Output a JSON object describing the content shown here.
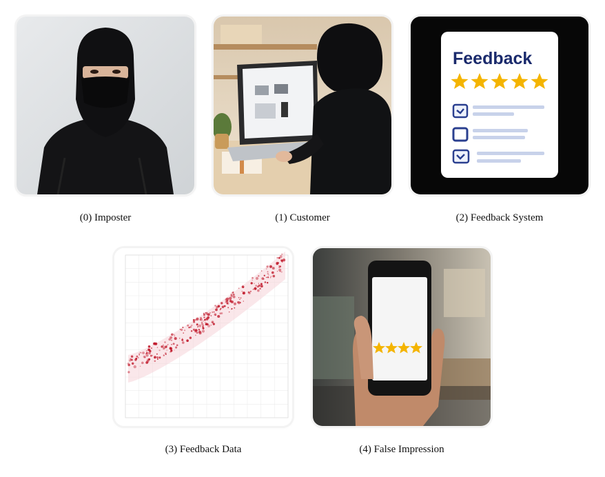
{
  "panels": [
    {
      "caption": "(0) Imposter",
      "icon": "imposter-photo"
    },
    {
      "caption": "(1) Customer",
      "icon": "customer-photo"
    },
    {
      "caption": "(2) Feedback System",
      "icon": "feedback-form-illustration",
      "card_title": "Feedback",
      "stars": 5
    },
    {
      "caption": "(3) Feedback Data",
      "icon": "scatter-plot-image"
    },
    {
      "caption": "(4) False Impression",
      "icon": "phone-rating-photo",
      "stars_shown": 4
    }
  ],
  "colors": {
    "feedback_title": "#1a2a6c",
    "star": "#f4b400",
    "scatter": "#c0182a"
  }
}
